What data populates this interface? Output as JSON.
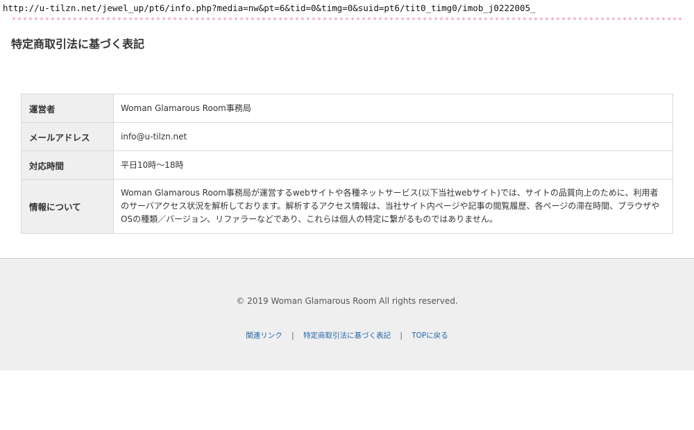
{
  "browser": {
    "url": "http://u-tilzn.net/jewel_up/pt6/info.php?media=nw&pt=6&tid=0&timg=0&suid=pt6/tit0_timg0/imob_j0222005_"
  },
  "page": {
    "title": "特定商取引法に基づく表記"
  },
  "info_table": {
    "rows": [
      {
        "label": "運営者",
        "value": "Woman Glamarous Room事務局"
      },
      {
        "label": "メールアドレス",
        "value": "info@u-tilzn.net"
      },
      {
        "label": "対応時間",
        "value": "平日10時～18時"
      },
      {
        "label": "情報について",
        "value": "Woman Glamarous Room事務局が運営するwebサイトや各種ネットサービス(以下当社webサイト)では、サイトの品質向上のために、利用者のサーバアクセス状況を解析しております。解析するアクセス情報は、当社サイト内ページや記事の閲覧履歴、各ページの滞在時間、ブラウザやOSの種類／バージョン、リファラーなどであり、これらは個人の特定に繋がるものではありません。"
      }
    ]
  },
  "footer": {
    "copyright": "© 2019 Woman Glamarous Room All rights reserved.",
    "links": [
      "関連リンク",
      "特定商取引法に基づく表記",
      "TOPに戻る"
    ],
    "separator": "|",
    "link_color": "#2266aa"
  },
  "colors": {
    "dots": "#f4a9c8",
    "footer_bg": "#efefef",
    "label_bg": "#efefef"
  }
}
